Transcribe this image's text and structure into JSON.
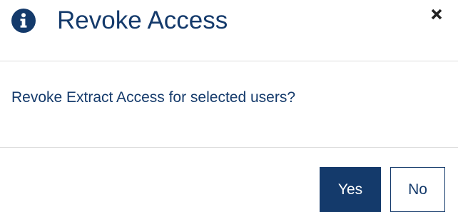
{
  "dialog": {
    "title": "Revoke Access",
    "message": "Revoke Extract Access for selected users?",
    "header_icon": "info-icon",
    "close_icon": "close-icon",
    "buttons": {
      "yes_label": "Yes",
      "no_label": "No"
    }
  },
  "colors": {
    "primary": "#143a6b",
    "close_icon": "#222222",
    "divider": "#dcdcdc",
    "background": "#ffffff"
  }
}
